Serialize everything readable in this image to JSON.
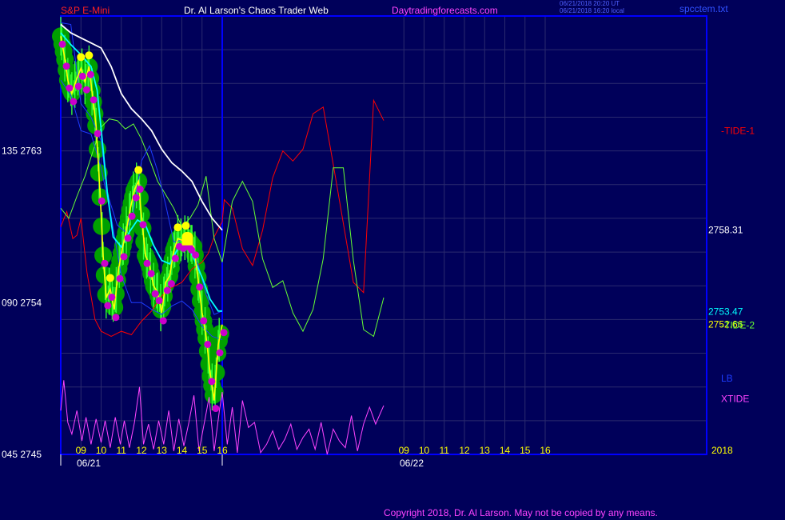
{
  "header": {
    "instrument": "S&P E-Mini",
    "site": "Dr. Al Larson's Chaos Trader Web",
    "domain": "Daytradingforecasts.com",
    "time_ut": "06/21/2018 20:20 UT",
    "time_local": "06/21/2018 16:20 local",
    "file": "spcctem.txt"
  },
  "footer": {
    "copyright": "Copyright 2018, Dr. Al Larson. May not be copied by any means."
  },
  "colors": {
    "background": "#00005a",
    "frame": "#0000ff",
    "grid": "#2a2a6e",
    "price": "#ffff00",
    "avg_fast": "#00ffff",
    "avg_slow": "#ffffff",
    "tide1": "#ff0000",
    "tide2": "#66ff33",
    "lb": "#1d3bff",
    "xtide": "#ff44ff",
    "bubble": "#00a000",
    "dot_top": "#ffff00",
    "dot_bottom": "#cc00cc"
  },
  "chart_data": {
    "type": "line",
    "y_axis": {
      "range": [
        2745,
        2771
      ],
      "ticks": [
        {
          "price": 2763,
          "label": "135  2763"
        },
        {
          "price": 2754,
          "label": "090  2754"
        },
        {
          "price": 2745,
          "label": "045  2745"
        }
      ]
    },
    "x_axis": {
      "range_hours": [
        8.0,
        40.0
      ],
      "date_labels": [
        {
          "hour": 8.0,
          "label": "06/21"
        },
        {
          "hour": 24.0,
          "label": "06/22"
        }
      ],
      "hour_ticks": [
        {
          "hour": 9,
          "label": "09"
        },
        {
          "hour": 10,
          "label": "10"
        },
        {
          "hour": 11,
          "label": "11"
        },
        {
          "hour": 12,
          "label": "12"
        },
        {
          "hour": 13,
          "label": "13"
        },
        {
          "hour": 14,
          "label": "14"
        },
        {
          "hour": 15,
          "label": "15"
        },
        {
          "hour": 16,
          "label": "16"
        },
        {
          "hour": 25,
          "label": "09"
        },
        {
          "hour": 26,
          "label": "10"
        },
        {
          "hour": 27,
          "label": "11"
        },
        {
          "hour": 28,
          "label": "12"
        },
        {
          "hour": 29,
          "label": "13"
        },
        {
          "hour": 30,
          "label": "14"
        },
        {
          "hour": 31,
          "label": "15"
        },
        {
          "hour": 32,
          "label": "16"
        }
      ],
      "now_hour": 16.0,
      "year_label": "2018"
    },
    "right_labels": [
      {
        "label": "-TIDE-1",
        "color": "#ff0000",
        "price": 2764.2
      },
      {
        "label": "2758.31",
        "color": "#ffffff",
        "price": 2758.31
      },
      {
        "label": "2753.47",
        "color": "#00ffff",
        "price": 2753.47
      },
      {
        "label": "2752.66",
        "color": "#ffff00",
        "price": 2752.7
      },
      {
        "label": "-TIDE-2",
        "color": "#66ff33",
        "price": 2752.66
      },
      {
        "label": "LB",
        "color": "#1d3bff",
        "price": 2749.5
      },
      {
        "label": "XTIDE",
        "color": "#ff44ff",
        "price": 2748.3
      }
    ],
    "series": [
      {
        "name": "price",
        "color": "#ffff00",
        "x": [
          8.0,
          8.2,
          8.35,
          8.55,
          8.8,
          9.0,
          9.2,
          9.4,
          9.55,
          9.75,
          9.95,
          10.1,
          10.25,
          10.45,
          10.65,
          10.85,
          11.05,
          11.25,
          11.45,
          11.65,
          11.85,
          12.0,
          12.2,
          12.4,
          12.6,
          12.8,
          13.0,
          13.2,
          13.4,
          13.6,
          13.8,
          14.0,
          14.2,
          14.4,
          14.6,
          14.8,
          15.0,
          15.2,
          15.4,
          15.6,
          15.8,
          16.0
        ],
        "values": [
          2769.8,
          2768.5,
          2767.2,
          2766.4,
          2767.3,
          2767.9,
          2767.1,
          2768.0,
          2766.5,
          2764.5,
          2760.5,
          2756.8,
          2754.3,
          2754.8,
          2753.6,
          2755.9,
          2757.2,
          2758.3,
          2759.6,
          2760.7,
          2761.2,
          2759.1,
          2756.8,
          2756.2,
          2755.0,
          2754.6,
          2753.4,
          2755.2,
          2755.6,
          2757.1,
          2757.8,
          2757.7,
          2757.9,
          2757.6,
          2757.3,
          2755.4,
          2753.4,
          2752.0,
          2749.8,
          2748.2,
          2751.5,
          2752.7
        ]
      },
      {
        "name": "avg_fast",
        "color": "#00ffff",
        "x": [
          8.0,
          8.5,
          9.0,
          9.5,
          9.8,
          10.0,
          10.3,
          10.6,
          11.0,
          11.4,
          11.8,
          12.2,
          12.6,
          13.0,
          13.4,
          13.8,
          14.2,
          14.6,
          15.0,
          15.4,
          15.8,
          16.0
        ],
        "values": [
          2770.0,
          2769.3,
          2768.7,
          2768.0,
          2766.6,
          2764.3,
          2760.6,
          2757.9,
          2757.3,
          2758.2,
          2758.9,
          2758.6,
          2757.4,
          2756.5,
          2756.3,
          2757.2,
          2757.6,
          2756.6,
          2755.5,
          2754.2,
          2753.5,
          2753.5
        ]
      },
      {
        "name": "avg_slow",
        "color": "#ffffff",
        "x": [
          8.0,
          8.5,
          9.0,
          9.5,
          10.0,
          10.5,
          11.0,
          11.5,
          12.0,
          12.5,
          13.0,
          13.5,
          14.0,
          14.5,
          15.0,
          15.5,
          16.0
        ],
        "values": [
          2770.5,
          2770.0,
          2769.7,
          2769.4,
          2769.1,
          2768.0,
          2766.4,
          2765.5,
          2764.9,
          2764.2,
          2763.1,
          2762.3,
          2761.8,
          2761.2,
          2760.0,
          2759.0,
          2758.3
        ]
      },
      {
        "name": "LB",
        "color": "#1d3bff",
        "x": [
          8.0,
          8.5,
          9.0,
          9.5,
          10.0,
          10.3,
          10.8,
          11.2,
          11.6,
          12.0,
          12.4,
          12.8,
          13.2,
          13.6,
          14.0,
          14.4,
          14.8,
          15.2,
          15.6,
          16.0
        ],
        "values": [
          2770.6,
          2770.5,
          2765.8,
          2765.0,
          2763.6,
          2760.5,
          2758.6,
          2758.2,
          2759.4,
          2762.4,
          2763.3,
          2761.8,
          2759.8,
          2757.6,
          2757.7,
          2757.2,
          2756.3,
          2754.5,
          2753.3,
          2753.5
        ]
      },
      {
        "name": "LB_lower",
        "color": "#1d3bff",
        "x": [
          8.0,
          8.5,
          9.0,
          9.5,
          10.0,
          10.5,
          11.0,
          11.5,
          12.0,
          12.5,
          13.0,
          13.5,
          14.0,
          14.5,
          15.0,
          15.5,
          16.0
        ],
        "values": [
          2767.2,
          2766.3,
          2764.2,
          2764.0,
          2762.0,
          2759.1,
          2755.6,
          2754.0,
          2754.0,
          2753.6,
          2753.3,
          2753.8,
          2754.1,
          2753.6,
          2752.6,
          2752.0,
          2751.8
        ]
      },
      {
        "name": "TIDE-1",
        "color": "#ff0000",
        "x": [
          8.0,
          8.3,
          8.6,
          8.8,
          9.0,
          9.3,
          9.7,
          10.0,
          10.5,
          11.0,
          11.5,
          12.0,
          12.5,
          13.0,
          13.5,
          14.0,
          14.5,
          15.0,
          15.3,
          15.6,
          15.9,
          16.0,
          16.1,
          16.5,
          17.0,
          17.5,
          18.0,
          18.5,
          19.0,
          19.5,
          20.0,
          20.5,
          21.0,
          21.5,
          22.0,
          22.5,
          23.0,
          23.5,
          24.0
        ],
        "values": [
          2758.5,
          2759.4,
          2757.8,
          2758.0,
          2759.0,
          2755.8,
          2753.0,
          2752.3,
          2752.0,
          2752.3,
          2752.1,
          2752.9,
          2753.5,
          2754.4,
          2754.9,
          2755.2,
          2756.0,
          2756.4,
          2756.9,
          2757.9,
          2758.6,
          2758.8,
          2760.1,
          2759.6,
          2757.2,
          2756.2,
          2758.3,
          2761.4,
          2763.0,
          2762.4,
          2763.1,
          2765.2,
          2765.6,
          2762.2,
          2758.7,
          2755.2,
          2754.6,
          2766.0,
          2764.8
        ]
      },
      {
        "name": "TIDE-2",
        "color": "#66ff33",
        "x": [
          8.0,
          8.4,
          8.8,
          9.2,
          9.6,
          10.0,
          10.4,
          10.8,
          11.2,
          11.6,
          12.0,
          12.4,
          12.8,
          13.2,
          13.6,
          14.0,
          14.4,
          14.8,
          15.2,
          15.6,
          16.0,
          16.5,
          17.0,
          17.5,
          18.0,
          18.5,
          19.0,
          19.5,
          20.0,
          20.5,
          21.0,
          21.5,
          22.0,
          22.5,
          23.0,
          23.5,
          24.0
        ],
        "values": [
          2759.6,
          2759.0,
          2760.3,
          2761.5,
          2763.0,
          2764.4,
          2764.9,
          2764.8,
          2764.3,
          2764.6,
          2763.7,
          2762.5,
          2761.2,
          2760.4,
          2759.6,
          2758.5,
          2759.0,
          2759.8,
          2761.5,
          2757.8,
          2756.4,
          2760.0,
          2761.2,
          2760.0,
          2756.6,
          2754.9,
          2755.3,
          2753.4,
          2752.3,
          2753.6,
          2756.6,
          2762.0,
          2762.0,
          2756.5,
          2752.4,
          2752.0,
          2754.3
        ]
      },
      {
        "name": "XTIDE",
        "color": "#ff44ff",
        "x": [
          8.0,
          8.15,
          8.35,
          8.55,
          8.8,
          9.05,
          9.25,
          9.5,
          9.75,
          10.0,
          10.2,
          10.45,
          10.7,
          10.95,
          11.15,
          11.4,
          11.65,
          11.9,
          12.1,
          12.35,
          12.6,
          12.85,
          13.1,
          13.35,
          13.6,
          13.85,
          14.1,
          14.35,
          14.6,
          14.85,
          15.1,
          15.35,
          15.6,
          15.85,
          16.0,
          16.25,
          16.5,
          16.75,
          17.0,
          17.3,
          17.6,
          17.9,
          18.2,
          18.5,
          18.8,
          19.1,
          19.4,
          19.7,
          20.0,
          20.3,
          20.6,
          20.9,
          21.2,
          21.5,
          21.8,
          22.1,
          22.4,
          22.7,
          23.0,
          23.3,
          23.6,
          24.0
        ],
        "values": [
          2747.6,
          2749.4,
          2746.9,
          2746.2,
          2747.6,
          2745.8,
          2747.2,
          2745.6,
          2747.1,
          2745.7,
          2747.0,
          2745.4,
          2747.2,
          2745.6,
          2747.0,
          2745.4,
          2746.9,
          2749.0,
          2745.6,
          2746.8,
          2745.3,
          2747.0,
          2745.6,
          2747.6,
          2745.2,
          2747.1,
          2745.5,
          2746.9,
          2748.5,
          2745.2,
          2746.8,
          2748.4,
          2745.2,
          2747.5,
          2748.7,
          2745.6,
          2747.8,
          2745.1,
          2748.2,
          2746.6,
          2746.9,
          2745.1,
          2745.6,
          2746.4,
          2745.3,
          2745.9,
          2746.8,
          2745.3,
          2746.0,
          2746.5,
          2745.3,
          2746.9,
          2745.0,
          2746.5,
          2745.8,
          2745.4,
          2747.3,
          2745.2,
          2746.8,
          2747.8,
          2746.8,
          2747.9
        ]
      }
    ],
    "bar_marker": {
      "x_from": 14.0,
      "x_to": 14.55,
      "y_from": 2757.4,
      "y_to": 2758.0
    }
  }
}
